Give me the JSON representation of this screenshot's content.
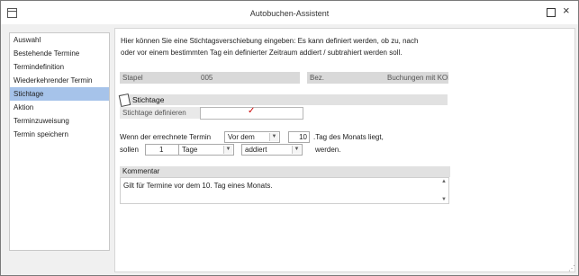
{
  "window": {
    "title": "Autobuchen-Assistent"
  },
  "nav": {
    "items": [
      {
        "label": "Auswahl"
      },
      {
        "label": "Bestehende Termine"
      },
      {
        "label": "Termindefinition"
      },
      {
        "label": "Wiederkehrender Termin"
      },
      {
        "label": "Stichtage",
        "selected": true
      },
      {
        "label": "Aktion"
      },
      {
        "label": "Terminzuweisung"
      },
      {
        "label": "Termin speichern"
      }
    ]
  },
  "intro": {
    "line1": "Hier können Sie eine Stichtagsverschiebung eingeben: Es kann definiert werden, ob zu, nach",
    "line2": "oder vor einem bestimmten Tag ein definierter Zeitraum addiert / subtrahiert werden soll."
  },
  "stapel": {
    "label": "Stapel",
    "value": "005"
  },
  "bez": {
    "label": "Bez.",
    "value": "Buchungen mit KOR"
  },
  "section": {
    "title": "Stichtage"
  },
  "define": {
    "label": "Stichtage definieren",
    "checked": true
  },
  "sentence": {
    "part1": "Wenn der errechnete Termin",
    "dropdown_position": "Vor dem",
    "day_value": "10",
    "part2": ".Tag des Monats liegt,",
    "part3": "sollen",
    "count_value": "1",
    "dropdown_unit": "Tage",
    "dropdown_action": "addiert",
    "part4": "werden."
  },
  "comment": {
    "label": "Kommentar",
    "text": "Gilt für Termine vor dem 10. Tag eines Monats."
  },
  "icons": {
    "app": "window-icon",
    "maximize": "maximize-icon",
    "close": "close-icon",
    "section": "calendar-icon",
    "check": "checkmark-icon",
    "dropdown": "chevron-down-icon"
  }
}
